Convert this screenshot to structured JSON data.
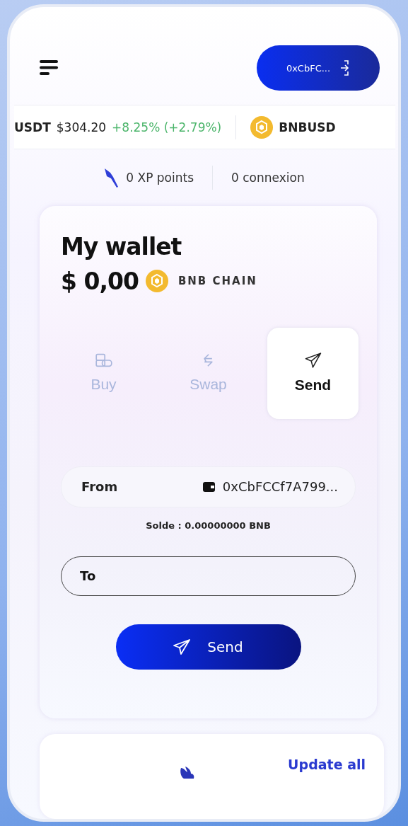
{
  "header": {
    "wallet_button": "0xCbFC..."
  },
  "ticker": [
    {
      "kind": "pair",
      "symbol": "USDT",
      "price": "$304.20",
      "change": "+8.25% (+2.79%)"
    },
    {
      "kind": "coin",
      "symbol": "BNBUSD"
    }
  ],
  "stats": {
    "xp": "0 XP points",
    "connections": "0 connexion"
  },
  "wallet": {
    "title": "My wallet",
    "balance": "$ 0,00",
    "chain": "BNB CHAIN",
    "actions": [
      {
        "kind": "buy",
        "label": "Buy",
        "selected": false
      },
      {
        "kind": "swap",
        "label": "Swap",
        "selected": false
      },
      {
        "kind": "send",
        "label": "Send",
        "selected": true
      }
    ],
    "from_label": "From",
    "from_address": "0xCbFCCf7A799...",
    "solde": "Solde : 0.00000000 BNB",
    "to_placeholder": "To",
    "send_button": "Send"
  },
  "footer": {
    "update_all": "Update all"
  }
}
